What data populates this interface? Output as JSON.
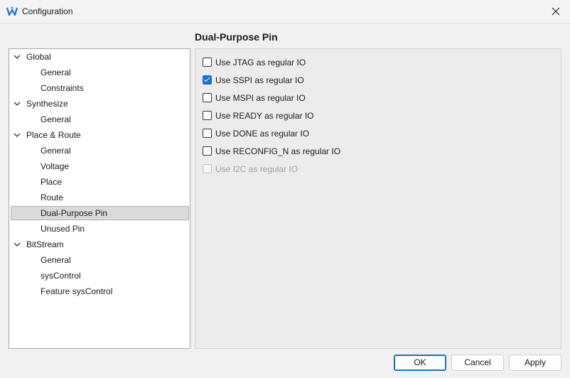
{
  "window": {
    "title": "Configuration"
  },
  "page": {
    "title": "Dual-Purpose Pin"
  },
  "tree": [
    {
      "label": "Global",
      "level": 0,
      "expanded": true
    },
    {
      "label": "General",
      "level": 1
    },
    {
      "label": "Constraints",
      "level": 1
    },
    {
      "label": "Synthesize",
      "level": 0,
      "expanded": true
    },
    {
      "label": "General",
      "level": 1
    },
    {
      "label": "Place & Route",
      "level": 0,
      "expanded": true
    },
    {
      "label": "General",
      "level": 1
    },
    {
      "label": "Voltage",
      "level": 1
    },
    {
      "label": "Place",
      "level": 1
    },
    {
      "label": "Route",
      "level": 1
    },
    {
      "label": "Dual-Purpose Pin",
      "level": 1,
      "selected": true
    },
    {
      "label": "Unused Pin",
      "level": 1
    },
    {
      "label": "BitStream",
      "level": 0,
      "expanded": true
    },
    {
      "label": "General",
      "level": 1
    },
    {
      "label": "sysControl",
      "level": 1
    },
    {
      "label": "Feature sysControl",
      "level": 1
    }
  ],
  "options": [
    {
      "label": "Use JTAG as regular IO",
      "checked": false,
      "enabled": true
    },
    {
      "label": "Use SSPI as regular IO",
      "checked": true,
      "enabled": true
    },
    {
      "label": "Use MSPI as regular IO",
      "checked": false,
      "enabled": true
    },
    {
      "label": "Use READY as regular IO",
      "checked": false,
      "enabled": true
    },
    {
      "label": "Use DONE as regular IO",
      "checked": false,
      "enabled": true
    },
    {
      "label": "Use RECONFIG_N as regular IO",
      "checked": false,
      "enabled": true
    },
    {
      "label": "Use I2C as regular IO",
      "checked": false,
      "enabled": false
    }
  ],
  "buttons": {
    "ok": "OK",
    "cancel": "Cancel",
    "apply": "Apply"
  },
  "colors": {
    "accent": "#1a6fd0",
    "selection": "#dadada"
  }
}
